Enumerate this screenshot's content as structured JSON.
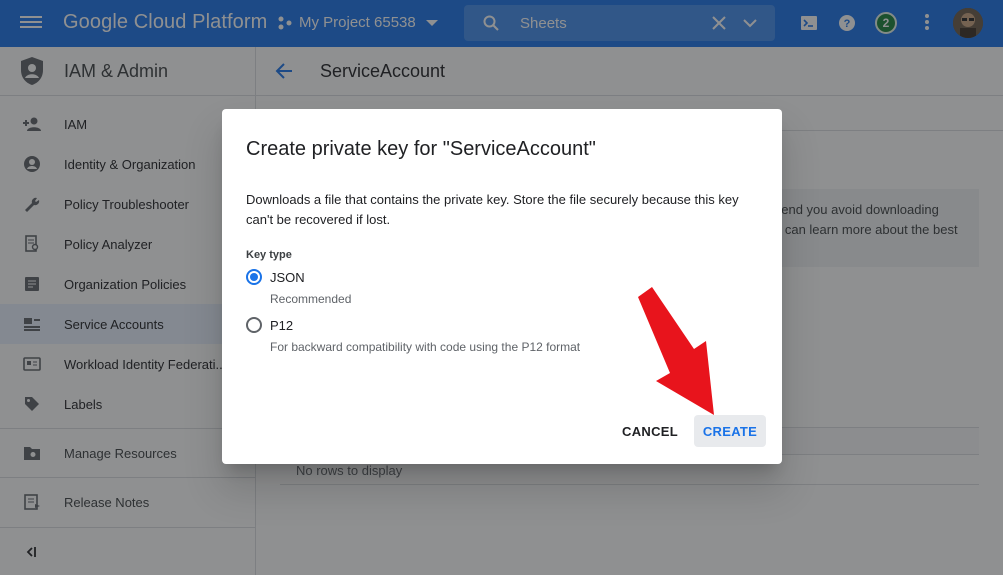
{
  "topbar": {
    "brand": "Google Cloud Platform",
    "project": "My Project 65538",
    "search_value": "Sheets",
    "notification_count": "2"
  },
  "sidebar": {
    "title": "IAM & Admin",
    "items": [
      {
        "label": "IAM",
        "icon": "person-add-icon"
      },
      {
        "label": "Identity & Organization",
        "icon": "account-circle-icon"
      },
      {
        "label": "Policy Troubleshooter",
        "icon": "wrench-icon"
      },
      {
        "label": "Policy Analyzer",
        "icon": "document-search-icon"
      },
      {
        "label": "Organization Policies",
        "icon": "list-doc-icon"
      },
      {
        "label": "Service Accounts",
        "icon": "service-account-icon"
      },
      {
        "label": "Workload Identity Federati...",
        "icon": "id-card-icon"
      },
      {
        "label": "Labels",
        "icon": "label-icon"
      }
    ],
    "manage_resources": "Manage Resources",
    "release_notes": "Release Notes"
  },
  "main": {
    "title": "ServiceAccount",
    "info_line1": "nend you avoid downloading",
    "info_line2": "u can learn more about the best",
    "no_rows": "No rows to display"
  },
  "dialog": {
    "title": "Create private key for \"ServiceAccount\"",
    "description": "Downloads a file that contains the private key. Store the file securely because this key can't be recovered if lost.",
    "key_type_label": "Key type",
    "options": [
      {
        "label": "JSON",
        "help": "Recommended",
        "selected": true
      },
      {
        "label": "P12",
        "help": "For backward compatibility with code using the P12 format",
        "selected": false
      }
    ],
    "cancel_label": "CANCEL",
    "create_label": "CREATE"
  },
  "colors": {
    "primary": "#1a73e8",
    "annotation_arrow": "#e8141c"
  }
}
